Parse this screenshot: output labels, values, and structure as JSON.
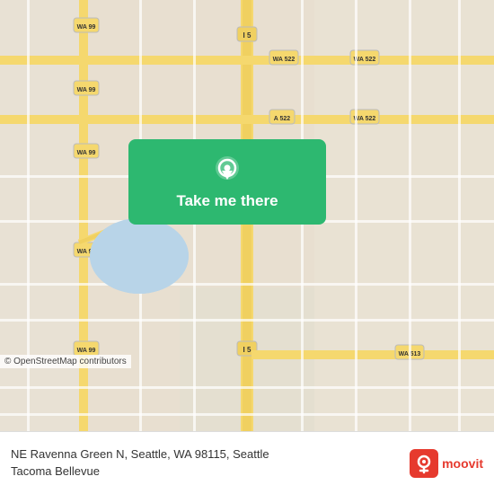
{
  "map": {
    "background_color": "#e8e0d8",
    "roads": {
      "highway_color": "#f5d86e",
      "major_road_color": "#f5d86e",
      "minor_road_color": "#ffffff",
      "water_color": "#a8d4f0"
    },
    "route_labels": [
      "WA 99",
      "WA 522",
      "I 5",
      "WA 513",
      "A 522"
    ]
  },
  "button": {
    "label": "Take me there",
    "background": "#2db870",
    "icon": "location-pin-icon"
  },
  "attribution": {
    "text": "© OpenStreetMap contributors"
  },
  "info_bar": {
    "address": "NE Ravenna Green N, Seattle, WA 98115, Seattle\nTacoma Bellevue",
    "logo_text": "moovit"
  }
}
